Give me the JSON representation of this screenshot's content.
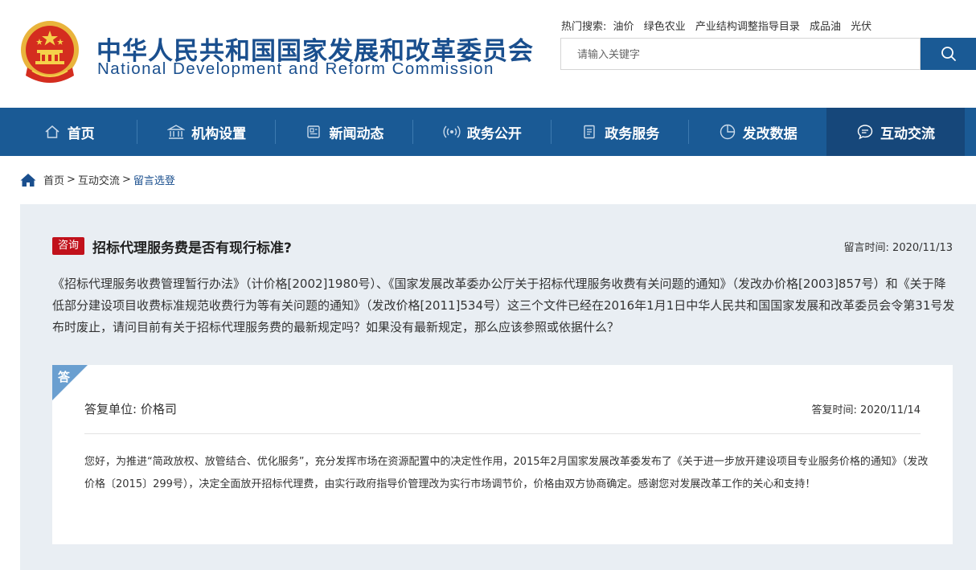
{
  "header": {
    "title_cn": "中华人民共和国国家发展和改革委员会",
    "title_en": "National Development and Reform Commission",
    "hot_search_label": "热门搜索:",
    "hot_search_items": [
      "油价",
      "绿色农业",
      "产业结构调整指导目录",
      "成品油",
      "光伏"
    ],
    "search_placeholder": "请输入关键字"
  },
  "nav": {
    "items": [
      {
        "label": "首页",
        "icon": "home-icon"
      },
      {
        "label": "机构设置",
        "icon": "building-icon"
      },
      {
        "label": "新闻动态",
        "icon": "news-icon"
      },
      {
        "label": "政务公开",
        "icon": "broadcast-icon"
      },
      {
        "label": "政务服务",
        "icon": "document-icon"
      },
      {
        "label": "发改数据",
        "icon": "pie-chart-icon"
      },
      {
        "label": "互动交流",
        "icon": "chat-icon"
      }
    ],
    "active_index": 6
  },
  "breadcrumb": {
    "home": "首页",
    "section": "互动交流",
    "current": "留言选登",
    "separator": ">"
  },
  "question": {
    "tag": "咨询",
    "title": "招标代理服务费是否有现行标准?",
    "time": "留言时间:  2020/11/13",
    "body": "《招标代理服务收费管理暂行办法》（计价格[2002]1980号）、《国家发展改革委办公厅关于招标代理服务收费有关问题的通知》（发改办价格[2003]857号）和《关于降低部分建设项目收费标准规范收费行为等有关问题的通知》（发改价格[2011]534号）这三个文件已经在2016年1月1日中华人民共和国国家发展和改革委员会令第31号发布时废止，请问目前有关于招标代理服务费的最新规定吗？如果没有最新规定，那么应该参照或依据什么？"
  },
  "answer": {
    "corner_label": "答",
    "unit": "答复单位:  价格司",
    "time": "答复时间:  2020/11/14",
    "body": "您好，为推进“简政放权、放管结合、优化服务”，充分发挥市场在资源配置中的决定性作用，2015年2月国家发展改革委发布了《关于进一步放开建设项目专业服务价格的通知》（发改价格〔2015〕299号），决定全面放开招标代理费，由实行政府指导价管理改为实行市场调节价，价格由双方协商确定。感谢您对发展改革工作的关心和支持！"
  },
  "colors": {
    "brand_blue": "#1a5a95",
    "nav_active": "#16477a",
    "title_blue": "#1a4f8e",
    "tag_red": "#c1111b",
    "panel_bg": "#e9eef3",
    "corner_blue": "#6a9fd0"
  }
}
